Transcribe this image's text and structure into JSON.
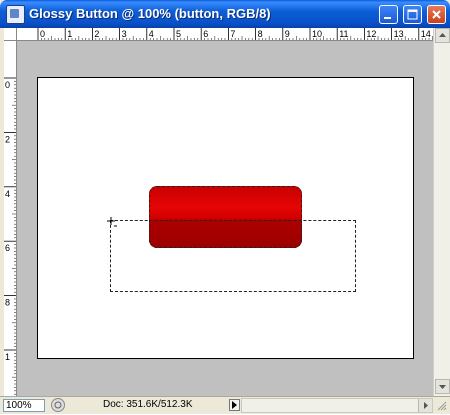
{
  "window": {
    "title": "Glossy Button @ 100% (button, RGB/8)"
  },
  "titlebar_buttons": {
    "minimize_icon": "minimize-icon",
    "maximize_icon": "maximize-icon",
    "close_icon": "close-icon"
  },
  "rulers": {
    "horizontal_labels": [
      "0",
      "1",
      "2",
      "3",
      "4",
      "5",
      "6",
      "7",
      "8",
      "9",
      "10",
      "11",
      "12",
      "13",
      "14"
    ],
    "vertical_labels": [
      "0",
      "2",
      "4",
      "6",
      "8",
      "1"
    ],
    "unit": "cm"
  },
  "canvas": {
    "button_color_top": "#e60505",
    "button_color_bottom": "#9c0000",
    "workspace_color": "#c0c0c0"
  },
  "statusbar": {
    "zoom": "100%",
    "doc_info": "Doc: 351.6K/512.3K"
  }
}
